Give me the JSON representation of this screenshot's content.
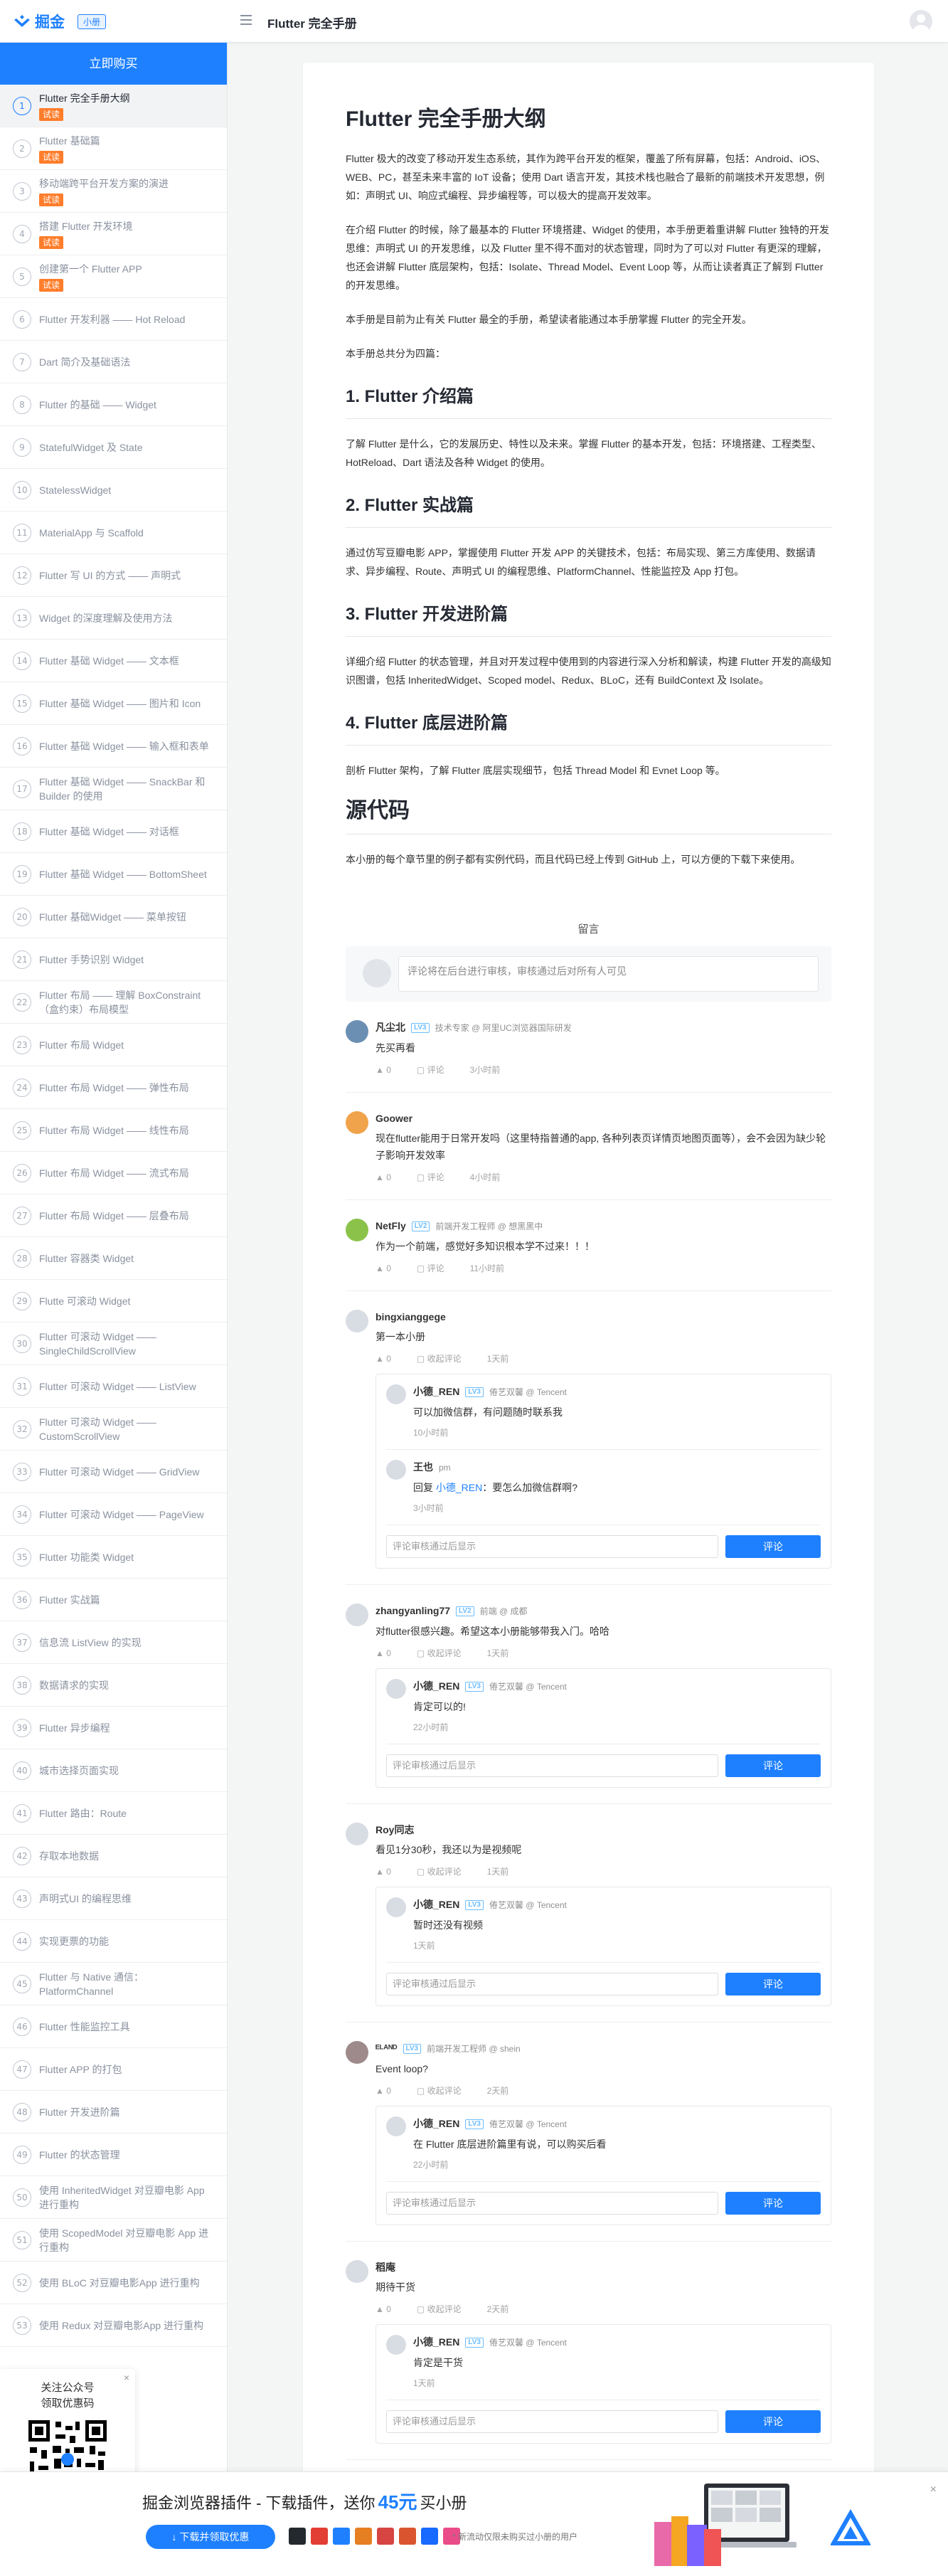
{
  "header": {
    "logo_text": "掘金",
    "badge": "小册",
    "book_title": "Flutter 完全手册"
  },
  "sidebar": {
    "buy_label": "立即购买",
    "trial_tag": "试读",
    "chapters": [
      {
        "num": "1",
        "title": "Flutter 完全手册大纲",
        "trial": true
      },
      {
        "num": "2",
        "title": "Flutter 基础篇",
        "trial": true
      },
      {
        "num": "3",
        "title": "移动端跨平台开发方案的演进",
        "trial": true
      },
      {
        "num": "4",
        "title": "搭建 Flutter 开发环境",
        "trial": true
      },
      {
        "num": "5",
        "title": "创建第一个 Flutter APP",
        "trial": true
      },
      {
        "num": "6",
        "title": "Flutter 开发利器 —— Hot Reload"
      },
      {
        "num": "7",
        "title": "Dart 简介及基础语法"
      },
      {
        "num": "8",
        "title": "Flutter 的基础 —— Widget"
      },
      {
        "num": "9",
        "title": "StatefulWidget 及 State"
      },
      {
        "num": "10",
        "title": "StatelessWidget"
      },
      {
        "num": "11",
        "title": "MaterialApp 与 Scaffold"
      },
      {
        "num": "12",
        "title": "Flutter 写 UI 的方式 —— 声明式"
      },
      {
        "num": "13",
        "title": "Widget 的深度理解及使用方法"
      },
      {
        "num": "14",
        "title": "Flutter 基础 Widget —— 文本框"
      },
      {
        "num": "15",
        "title": "Flutter 基础 Widget —— 图片和 Icon"
      },
      {
        "num": "16",
        "title": "Flutter 基础 Widget —— 输入框和表单"
      },
      {
        "num": "17",
        "title": "Flutter 基础 Widget —— SnackBar 和 Builder 的使用"
      },
      {
        "num": "18",
        "title": "Flutter 基础 Widget —— 对话框"
      },
      {
        "num": "19",
        "title": "Flutter 基础 Widget —— BottomSheet"
      },
      {
        "num": "20",
        "title": "Flutter 基础Widget —— 菜单按钮"
      },
      {
        "num": "21",
        "title": "Flutter 手势识别 Widget"
      },
      {
        "num": "22",
        "title": "Flutter 布局 —— 理解 BoxConstraint（盒约束）布局模型"
      },
      {
        "num": "23",
        "title": "Flutter 布局 Widget"
      },
      {
        "num": "24",
        "title": "Flutter 布局 Widget —— 弹性布局"
      },
      {
        "num": "25",
        "title": "Flutter 布局 Widget —— 线性布局"
      },
      {
        "num": "26",
        "title": "Flutter 布局 Widget —— 流式布局"
      },
      {
        "num": "27",
        "title": "Flutter 布局 Widget —— 层叠布局"
      },
      {
        "num": "28",
        "title": "Flutter 容器类 Widget"
      },
      {
        "num": "29",
        "title": "Flutte 可滚动 Widget"
      },
      {
        "num": "30",
        "title": "Flutter 可滚动 Widget —— SingleChildScrollView"
      },
      {
        "num": "31",
        "title": "Flutter 可滚动 Widget —— ListView"
      },
      {
        "num": "32",
        "title": "Flutter 可滚动 Widget —— CustomScrollView"
      },
      {
        "num": "33",
        "title": "Flutter 可滚动 Widget —— GridView"
      },
      {
        "num": "34",
        "title": "Flutter 可滚动 Widget —— PageView"
      },
      {
        "num": "35",
        "title": "Flutter 功能类 Widget"
      },
      {
        "num": "36",
        "title": "Flutter 实战篇"
      },
      {
        "num": "37",
        "title": "信息流 ListView 的实现"
      },
      {
        "num": "38",
        "title": "数据请求的实现"
      },
      {
        "num": "39",
        "title": "Flutter 异步编程"
      },
      {
        "num": "40",
        "title": "城市选择页面实现"
      },
      {
        "num": "41",
        "title": "Flutter 路由：Route"
      },
      {
        "num": "42",
        "title": "存取本地数据"
      },
      {
        "num": "43",
        "title": "声明式UI 的编程思维"
      },
      {
        "num": "44",
        "title": "实现更票的功能"
      },
      {
        "num": "45",
        "title": "Flutter 与 Native 通信：PlatformChannel"
      },
      {
        "num": "46",
        "title": "Flutter 性能监控工具"
      },
      {
        "num": "47",
        "title": "Flutter APP 的打包"
      },
      {
        "num": "48",
        "title": "Flutter 开发进阶篇"
      },
      {
        "num": "49",
        "title": "Flutter 的状态管理"
      },
      {
        "num": "50",
        "title": "使用 InheritedWidget 对豆瓣电影 App 进行重构"
      },
      {
        "num": "51",
        "title": "使用 ScopedModel 对豆瓣电影 App 进行重构"
      },
      {
        "num": "52",
        "title": "使用 BLoC 对豆瓣电影App 进行重构"
      },
      {
        "num": "53",
        "title": "使用 Redux 对豆瓣电影App 进行重构"
      }
    ],
    "qr": {
      "line1": "关注公众号",
      "line2": "领取优惠码",
      "close": "×"
    }
  },
  "article": {
    "title": "Flutter 完全手册大纲",
    "p1": "Flutter 极大的改变了移动开发生态系统，其作为跨平台开发的框架，覆盖了所有屏幕，包括：Android、iOS、WEB、PC，甚至未来丰富的 IoT 设备；使用 Dart 语言开发，其技术栈也融合了最新的前端技术开发思想，例如：声明式 UI、响应式编程、异步编程等，可以极大的提高开发效率。",
    "p2": "在介绍 Flutter 的时候，除了最基本的 Flutter 环境搭建、Widget 的使用，本手册更着重讲解 Flutter 独特的开发思维：声明式 UI 的开发思维，以及 Flutter 里不得不面对的状态管理，同时为了可以对 Flutter 有更深的理解，也还会讲解 Flutter 底层架构，包括：Isolate、Thread Model、Event Loop 等，从而让读者真正了解到 Flutter 的开发思维。",
    "p3": "本手册是目前为止有关 Flutter 最全的手册，希望读者能通过本手册掌握 Flutter 的完全开发。",
    "p4": "本手册总共分为四篇：",
    "s1_title": "1. Flutter 介绍篇",
    "s1_text": "了解 Flutter 是什么，它的发展历史、特性以及未来。掌握 Flutter 的基本开发，包括：环境搭建、工程类型、HotReload、Dart 语法及各种 Widget 的使用。",
    "s2_title": "2. Flutter 实战篇",
    "s2_text": "通过仿写豆瓣电影 APP，掌握使用 Flutter 开发 APP 的关键技术，包括：布局实现、第三方库使用、数据请求、异步编程、Route、声明式 UI 的编程思维、PlatformChannel、性能监控及 App 打包。",
    "s3_title": "3. Flutter 开发进阶篇",
    "s3_text": "详细介绍 Flutter 的状态管理，并且对开发过程中使用到的内容进行深入分析和解读，构建 Flutter 开发的高级知识图谱，包括 InheritedWidget、Scoped model、Redux、BLoC，还有 BuildContext 及 Isolate。",
    "s4_title": "4. Flutter 底层进阶篇",
    "s4_text": "剖析 Flutter 架构，了解 Flutter 底层实现细节，包括 Thread Model 和 Evnet Loop 等。",
    "src_title": "源代码",
    "src_text": "本小册的每个章节里的例子都有实例代码，而且代码已经上传到 GitHub 上，可以方便的下载下来使用。"
  },
  "comments": {
    "title": "留言",
    "placeholder": "评论将在后台进行审核，审核通过后对所有人可见",
    "reply_placeholder": "评论审核通过后显示",
    "submit": "评论",
    "comment_label": "评论",
    "collapse_label": "收起评论",
    "items": [
      {
        "name": "凡尘北",
        "level": "LV3",
        "meta": "技术专家 @ 阿里UC浏览器国际研发",
        "text": "先买再看",
        "likes": "0",
        "time": "3小时前",
        "avatar": "#6b8fb3"
      },
      {
        "name": "Goower",
        "level": "",
        "meta": "",
        "text": "现在flutter能用于日常开发吗（这里特指普通的app, 各种列表页详情页地图页面等），会不会因为缺少轮子影响开发效率",
        "likes": "0",
        "time": "4小时前",
        "avatar": "#f0a34a"
      },
      {
        "name": "NetFly",
        "level": "LV2",
        "meta": "前端开发工程师 @ 想黑黑中",
        "text": "作为一个前端，感觉好多知识根本学不过来！！！",
        "likes": "0",
        "time": "11小时前",
        "avatar": "#8bc34a"
      },
      {
        "name": "bingxianggege",
        "level": "",
        "meta": "",
        "text": "第一本小册",
        "likes": "0",
        "time": "1天前",
        "avatar": "#d8dce3",
        "replies": [
          {
            "name": "小德_REN",
            "level": "LV3",
            "meta": "倦艺双馨 @ Tencent",
            "text": "可以加微信群，有问题随时联系我",
            "time": "10小时前"
          },
          {
            "name": "王也",
            "level": "",
            "meta": "pm",
            "text_prefix": "回复 ",
            "mention": "小德_REN",
            "text": "：要怎么加微信群啊?",
            "time": "3小时前"
          }
        ]
      },
      {
        "name": "zhangyanling77",
        "level": "LV2",
        "meta": "前端 @ 成都",
        "text": "对flutter很感兴趣。希望这本小册能够带我入门。哈哈",
        "likes": "0",
        "time": "1天前",
        "avatar": "#d8dce3",
        "replies": [
          {
            "name": "小德_REN",
            "level": "LV3",
            "meta": "倦艺双馨 @ Tencent",
            "text": "肯定可以的!",
            "time": "22小时前"
          }
        ]
      },
      {
        "name": "Roy同志",
        "level": "",
        "meta": "",
        "text": "看见1分30秒，我还以为是视频呢",
        "likes": "0",
        "time": "1天前",
        "avatar": "#d8dce3",
        "replies": [
          {
            "name": "小德_REN",
            "level": "LV3",
            "meta": "倦艺双馨 @ Tencent",
            "text": "暂时还没有视频",
            "time": "1天前"
          }
        ]
      },
      {
        "name": "ᴱᴸᴬᴺᴰ",
        "level": "LV3",
        "meta": "前端开发工程师 @ shein",
        "text": "Event loop?",
        "likes": "0",
        "time": "2天前",
        "avatar": "#9e8a8a",
        "replies": [
          {
            "name": "小德_REN",
            "level": "LV3",
            "meta": "倦艺双馨 @ Tencent",
            "text": "在 Flutter 底层进阶篇里有说，可以购买后看",
            "time": "22小时前"
          }
        ]
      },
      {
        "name": "稻庵",
        "level": "",
        "meta": "",
        "text": "期待干货",
        "likes": "0",
        "time": "2天前",
        "avatar": "#d8dce3",
        "replies": [
          {
            "name": "小德_REN",
            "level": "LV3",
            "meta": "倦艺双馨 @ Tencent",
            "text": "肯定是干货",
            "time": "1天前"
          }
        ]
      }
    ]
  },
  "banner": {
    "title_pre": "掘金浏览器插件 - 下载插件，送你",
    "amount": "45元",
    "title_post": "买小册",
    "button": "↓ 下载并领取优惠",
    "note": "* 新流动仅限未购买过小册的用户",
    "close": "×"
  },
  "colors": {
    "accent": "#1e80ff",
    "trial_tag": "#ff7d2b"
  }
}
